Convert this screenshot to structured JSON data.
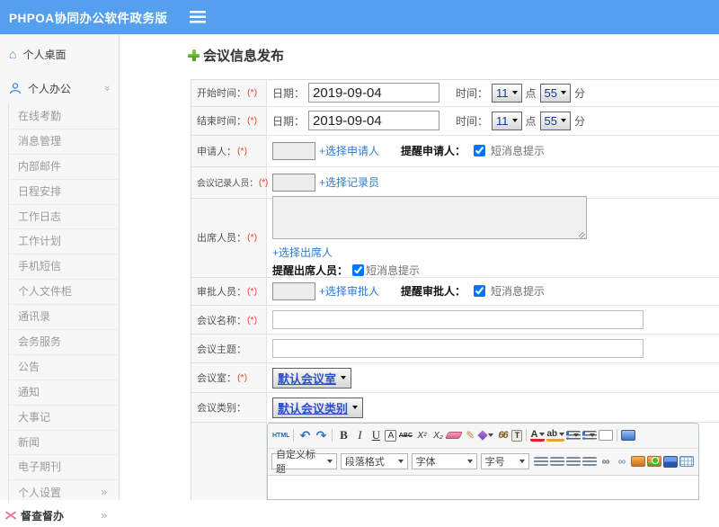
{
  "topbar": {
    "title": "PHPOA协同办公软件政务版"
  },
  "sidebar": {
    "desktop_label": "个人桌面",
    "office_label": "个人办公",
    "office_chevron": "»",
    "office_items": [
      "在线考勤",
      "消息管理",
      "内部邮件",
      "日程安排",
      "工作日志",
      "工作计划",
      "手机短信",
      "个人文件柜",
      "通讯录",
      "会务服务",
      "公告",
      "通知",
      "大事记",
      "新闻",
      "电子期刊"
    ],
    "settings_label": "个人设置",
    "settings_arrow": "»",
    "supervise_label": "督查督办",
    "supervise_arrow": "»"
  },
  "page": {
    "title": "会议信息发布"
  },
  "form": {
    "required_mark": "(*)",
    "start_time": {
      "label": "开始时间：",
      "date_label": "日期：",
      "date_value": "2019-09-04",
      "time_label": "时间：",
      "hour": "11",
      "hour_unit": "点",
      "minute": "55",
      "minute_unit": "分"
    },
    "end_time": {
      "label": "结束时间：",
      "date_label": "日期：",
      "date_value": "2019-09-04",
      "time_label": "时间：",
      "hour": "11",
      "hour_unit": "点",
      "minute": "55",
      "minute_unit": "分"
    },
    "applicant": {
      "label": "申请人：",
      "value": "",
      "link": "+选择申请人",
      "remind_label": "提醒申请人：",
      "sms_label": "短消息提示",
      "sms_checked": true
    },
    "recorder": {
      "label": "会议记录人员：",
      "value": "",
      "link": "+选择记录员"
    },
    "attendees": {
      "label": "出席人员：",
      "value": "",
      "link": "+选择出席人",
      "remind_label": "提醒出席人员：",
      "sms_label": "短消息提示",
      "sms_checked": true
    },
    "approver": {
      "label": "审批人员：",
      "value": "",
      "link": "+选择审批人",
      "remind_label": "提醒审批人：",
      "sms_label": "短消息提示",
      "sms_checked": true
    },
    "meeting_name": {
      "label": "会议名称：",
      "value": ""
    },
    "meeting_topic": {
      "label": "会议主题：",
      "value": ""
    },
    "meeting_room": {
      "label": "会议室：",
      "value": "默认会议室"
    },
    "meeting_category": {
      "label": "会议类别：",
      "value": "默认会议类别"
    }
  },
  "editor": {
    "selects": [
      "自定义标题",
      "段落格式",
      "字体",
      "字号"
    ],
    "content": "",
    "row1": [
      {
        "n": "html-source-button",
        "t": "HTML",
        "c": "htmlb"
      },
      {
        "s": 1
      },
      {
        "n": "undo-icon",
        "t": "↶",
        "c": "blu big"
      },
      {
        "n": "redo-icon",
        "t": "↷",
        "c": "blu big"
      },
      {
        "s": 1
      },
      {
        "n": "bold-button",
        "t": "B",
        "c": "bld"
      },
      {
        "n": "italic-button",
        "t": "I",
        "c": "itl"
      },
      {
        "n": "underline-button",
        "t": "U",
        "c": "und"
      },
      {
        "n": "font-frame-button",
        "t": "A",
        "c": "abox"
      },
      {
        "n": "strikethrough-button",
        "t": "ABC",
        "c": "strk"
      },
      {
        "n": "superscript-button",
        "t": "X²",
        "c": "subsup"
      },
      {
        "n": "subscript-button",
        "t": "X₂",
        "c": "subsup"
      },
      {
        "n": "eraser-icon",
        "c": "eraser"
      },
      {
        "n": "format-brush-icon",
        "t": "✎",
        "c": "org"
      },
      {
        "n": "magic-wand-icon",
        "c": "wand",
        "d": 1
      },
      {
        "n": "blockquote-button",
        "t": "66",
        "c": "quo"
      },
      {
        "n": "paste-icon",
        "t": "T",
        "c": "paste"
      },
      {
        "s": 1
      },
      {
        "n": "font-color-button",
        "t": "A",
        "c": "fcol",
        "d": 1
      },
      {
        "n": "highlight-color-button",
        "t": "ab",
        "c": "hcol",
        "d": 1
      },
      {
        "n": "ordered-list-button",
        "c": "olist",
        "d": 1
      },
      {
        "n": "unordered-list-button",
        "c": "ulist",
        "d": 1
      },
      {
        "n": "new-page-icon",
        "c": "pageic"
      },
      {
        "s": 1
      },
      {
        "n": "fullscreen-icon",
        "c": "monitor"
      }
    ],
    "row2_icons": [
      {
        "n": "align-left-icon",
        "c": "bars"
      },
      {
        "n": "align-center-icon",
        "c": "bars"
      },
      {
        "n": "align-right-icon",
        "c": "bars"
      },
      {
        "n": "align-justify-icon",
        "c": "bars"
      },
      {
        "n": "link-icon",
        "t": "∞",
        "c": "lnk"
      },
      {
        "n": "unlink-icon",
        "t": "∞",
        "c": "lnk broken"
      },
      {
        "n": "image-icon",
        "c": "imgic"
      },
      {
        "n": "insert-image-icon",
        "c": "imgic plus"
      },
      {
        "n": "media-icon",
        "c": "mediaic"
      },
      {
        "n": "table-icon",
        "c": "tableic"
      }
    ]
  },
  "colors": {
    "topbar_blue": "#55a0ee",
    "link_blue": "#2e7bcc",
    "required_red": "#e64533",
    "accent_green": "#62b52f",
    "sidebar_icon_blue": "#4a90e2",
    "supervise_pink": "#ee7198"
  }
}
